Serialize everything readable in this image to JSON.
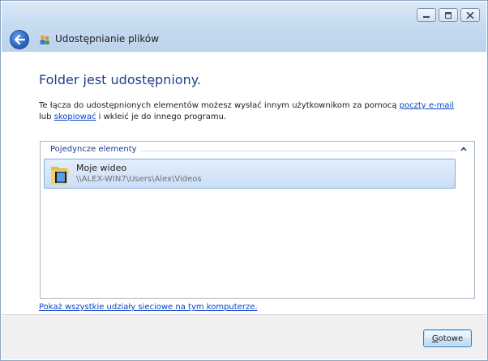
{
  "window": {
    "title": "Udostępnianie plików",
    "buttons": {
      "minimize": "minimize-icon",
      "maximize": "maximize-icon",
      "close": "close-icon"
    }
  },
  "main": {
    "heading": "Folder jest udostępniony.",
    "description_part1": "Te łącza do udostępnionych elementów możesz wysłać innym użytkownikom za pomocą ",
    "link_email": "poczty e-mail",
    "description_part2": "lub ",
    "link_copy": "skopiować",
    "description_part3": " i wkleić je do innego programu.",
    "group_header": "Pojedyncze elementy",
    "items": [
      {
        "name": "Moje wideo",
        "path": "\\\\ALEX-WIN7\\Users\\Alex\\Videos",
        "icon": "video-folder-icon"
      }
    ],
    "show_all_link": "Pokaż wszystkie udziały sieciowe na tym komputerze."
  },
  "footer": {
    "done_label_first": "G",
    "done_label_rest": "otowe"
  }
}
